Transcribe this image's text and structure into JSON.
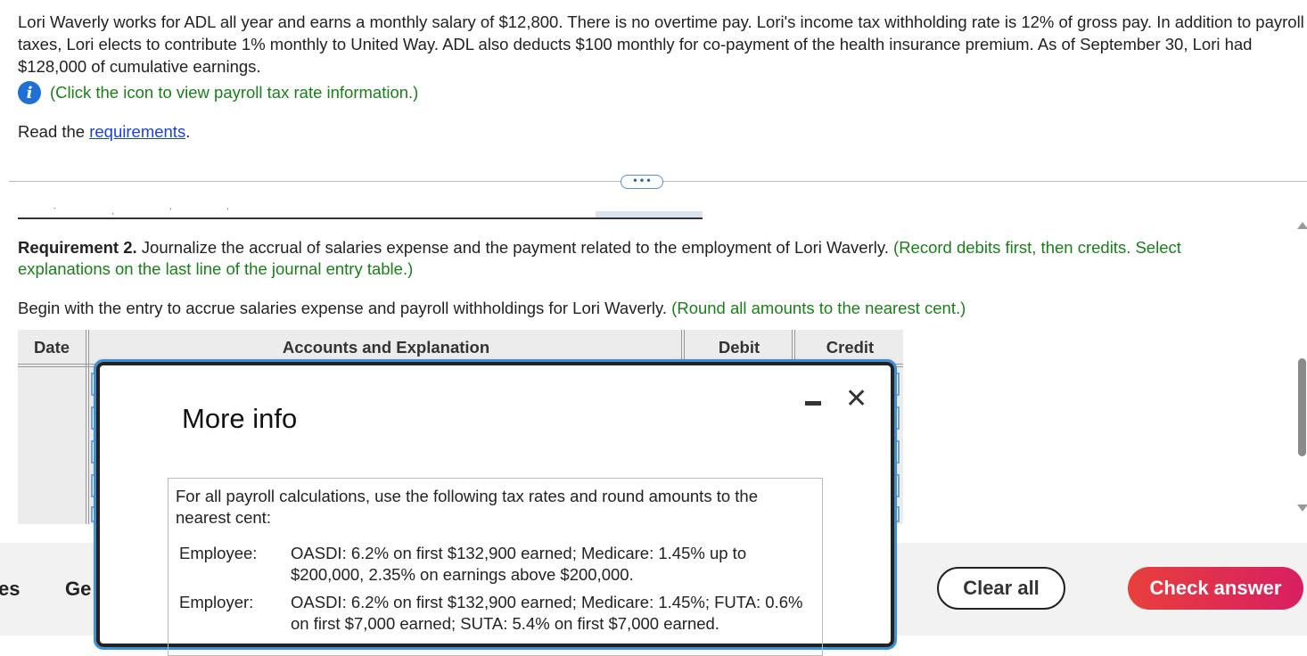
{
  "problem": {
    "text": "Lori Waverly works for ADL all year and earns a monthly salary of $12,800. There is no overtime pay. Lori's income tax withholding rate is 12% of gross pay. In addition to payroll taxes, Lori elects to contribute 1% monthly to United Way. ADL also deducts $100 monthly for co-payment of the health insurance premium. As of September 30, Lori had $128,000 of cumulative earnings.",
    "info_link": "(Click the icon to view payroll tax rate information.)",
    "read_prefix": "Read the ",
    "requirements_link": "requirements",
    "read_suffix": "."
  },
  "expand_label": "• • •",
  "requirement2": {
    "bold": "Requirement 2.",
    "text": " Journalize the accrual of salaries expense and the payment related to the employment of Lori Waverly. ",
    "green": "(Record debits first, then credits. Select explanations on the last line of the journal entry table.)"
  },
  "begin": {
    "text": "Begin with the entry to accrue salaries expense and payroll withholdings for Lori Waverly. ",
    "green": "(Round all amounts to the nearest cent.)"
  },
  "table": {
    "headers": {
      "date": "Date",
      "accounts": "Accounts and Explanation",
      "debit": "Debit",
      "credit": "Credit"
    }
  },
  "footer": {
    "left_partial_1": "es",
    "left_partial_2": "Ge",
    "clear_all": "Clear all",
    "check_answer": "Check answer"
  },
  "modal": {
    "title": "More info",
    "minimize_glyph": "",
    "close_glyph": "✕",
    "intro": "For all payroll calculations, use the following tax rates and round amounts to the nearest cent:",
    "rows": [
      {
        "label": "Employee:",
        "text": "OASDI: 6.2% on first $132,900 earned; Medicare: 1.45% up to $200,000, 2.35% on earnings above $200,000."
      },
      {
        "label": "Employer:",
        "text": "OASDI: 6.2% on first $132,900 earned; Medicare: 1.45%; FUTA: 0.6% on first $7,000 earned; SUTA: 5.4% on first $7,000 earned."
      }
    ]
  },
  "colors": {
    "green_text": "#1a7f1a",
    "link_blue": "#1a3fe0",
    "info_icon": "#1e6fd6",
    "modal_outline": "#3d8fd6",
    "check_button": "#e0305a"
  }
}
